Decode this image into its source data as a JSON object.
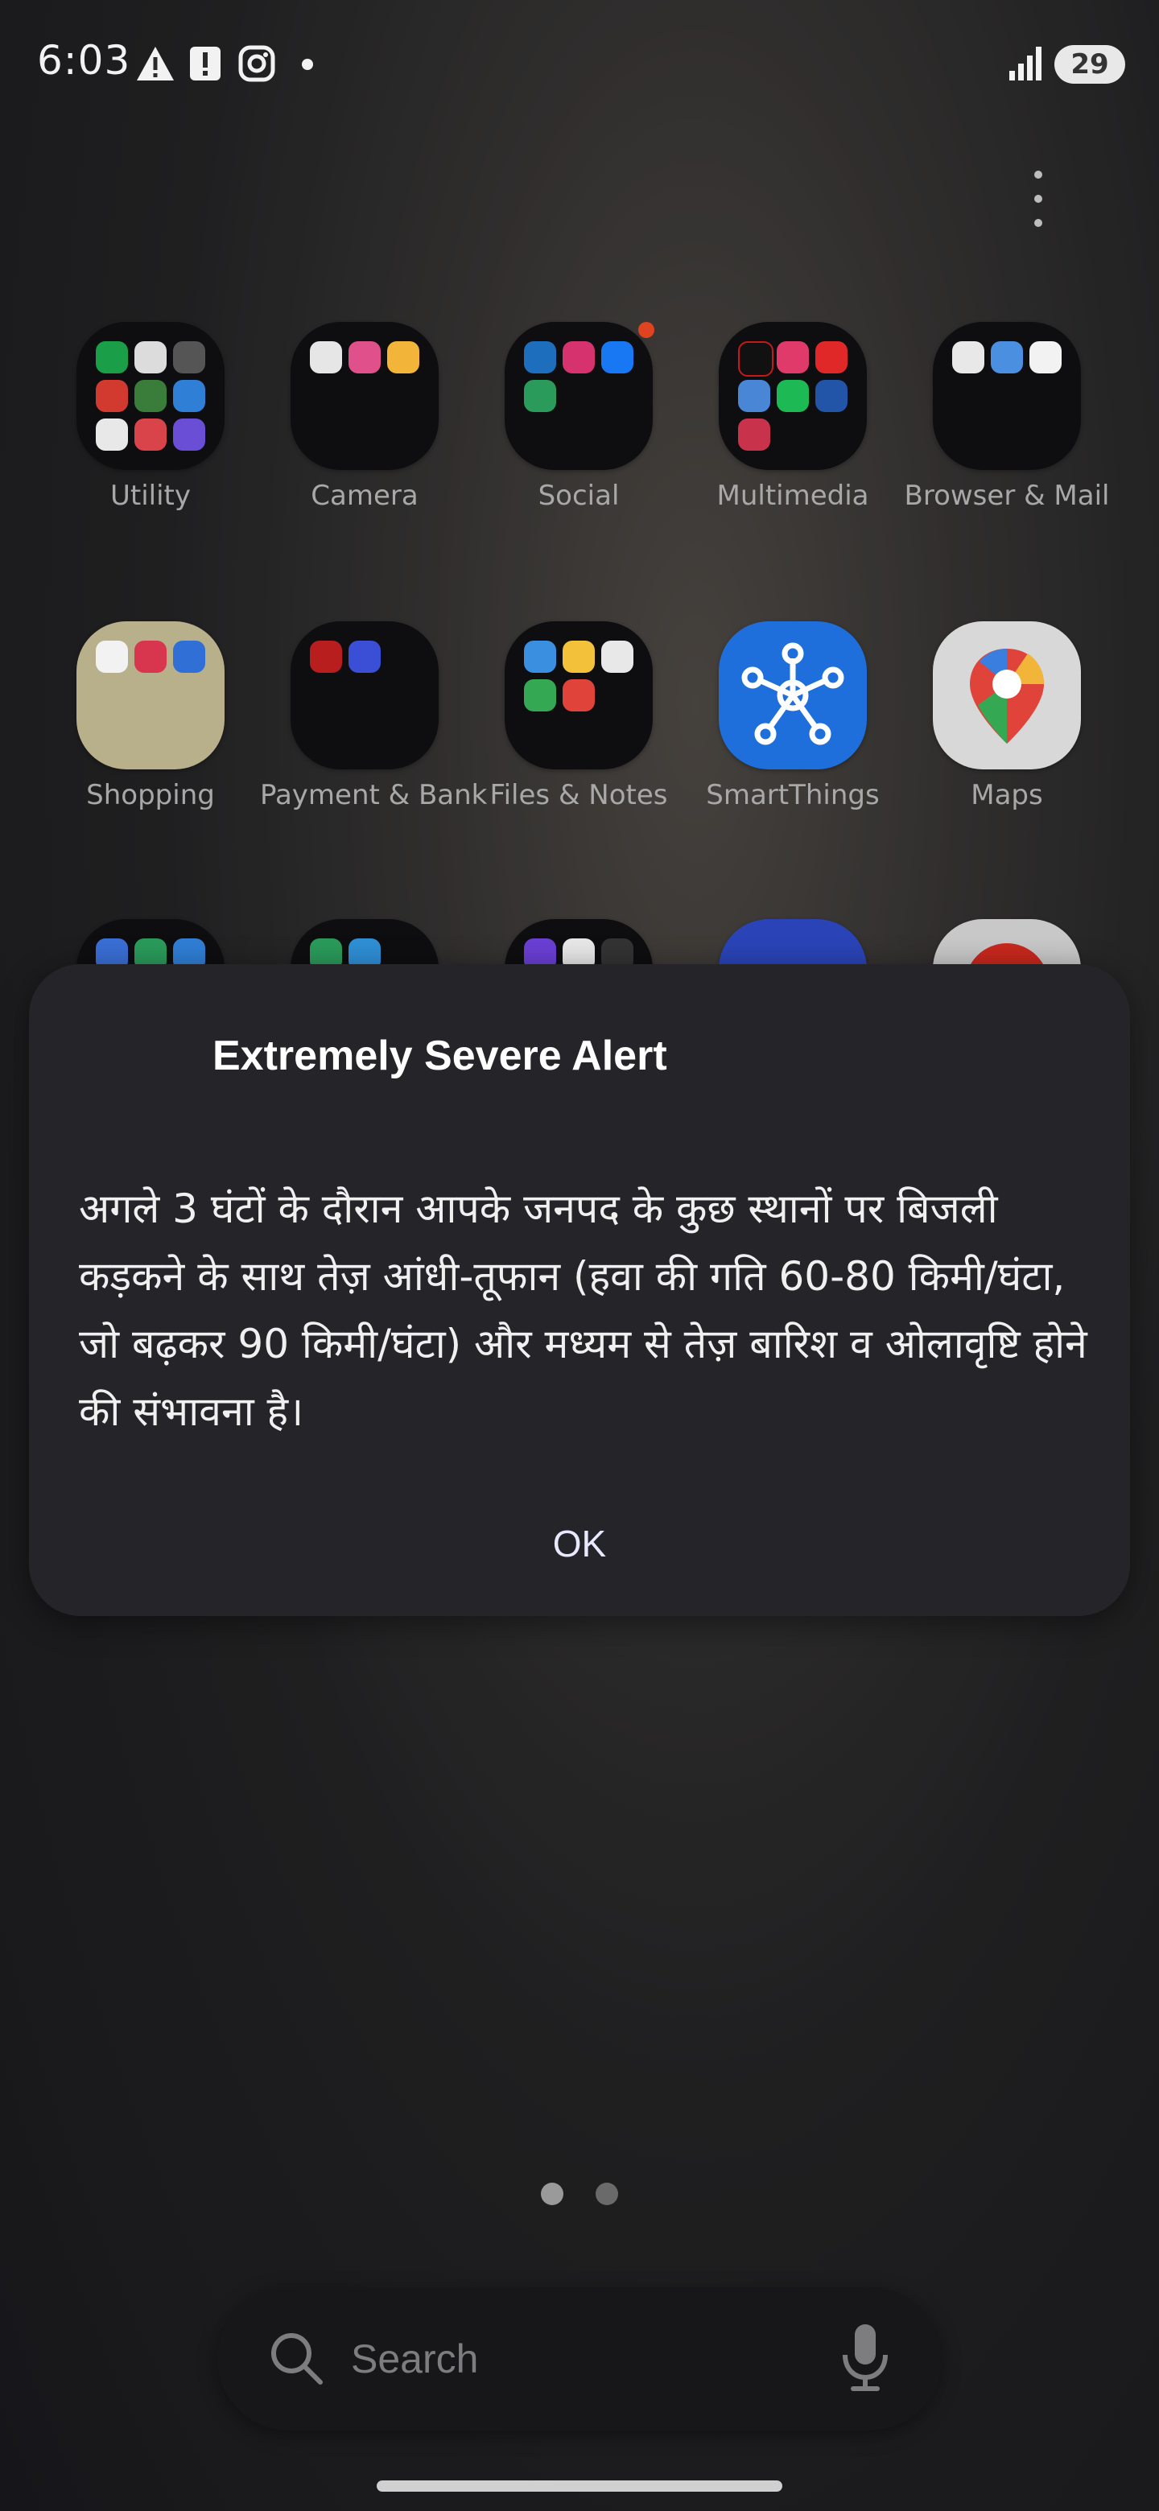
{
  "status_bar": {
    "time": "6:03",
    "battery": "29",
    "icons": [
      "warning-icon",
      "alert-icon",
      "instagram-icon",
      "dot-icon",
      "signal-icon",
      "battery-icon"
    ]
  },
  "home": {
    "apps_row1": [
      {
        "label": "Utility"
      },
      {
        "label": "Camera"
      },
      {
        "label": "Social"
      },
      {
        "label": "Multimedia"
      },
      {
        "label": "Browser & Mail"
      }
    ],
    "apps_row2": [
      {
        "label": "Shopping"
      },
      {
        "label": "Payment & Bank"
      },
      {
        "label": "Files & Notes"
      },
      {
        "label": "SmartThings"
      },
      {
        "label": "Maps"
      }
    ]
  },
  "dialog": {
    "title": "Extremely Severe Alert",
    "body": "अगले 3 घंटों के दौरान आपके जनपद के कुछ स्थानों पर बिजली कड़कने के साथ तेज़ आंधी-तूफान (हवा की गति 60-80 किमी/घंटा, जो बढ़कर 90 किमी/घंटा) और मध्यम से तेज़ बारिश व ओलावृष्टि होने की संभावना है।",
    "ok_label": "OK"
  },
  "search": {
    "placeholder": "Search"
  },
  "colors": {
    "dialog_bg": "#252428",
    "ok_text": "#e8e8ff",
    "smartthings_blue": "#1e6fdc"
  }
}
